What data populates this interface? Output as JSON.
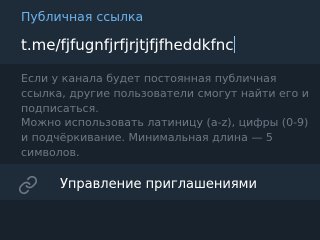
{
  "public_link": {
    "header": "Публичная ссылка",
    "value": "t.me/fjfugnfjrfjrjtjfjfheddkfnc"
  },
  "hints": {
    "text_1": "Если у канала будет постоянная публичная ссылка, другие пользователи смогут найти его и подписаться.",
    "text_2": "Можно использовать латиницу (a-z), цифры (0-9) и подчёркивание. Минимальная длина — 5 символов."
  },
  "invites": {
    "label": "Управление приглашениями",
    "icon": "link-icon"
  },
  "colors": {
    "background": "#18222d",
    "section": "#1e2c3a",
    "accent": "#6cb2eb",
    "hint": "#6c7883",
    "text": "#ffffff"
  }
}
